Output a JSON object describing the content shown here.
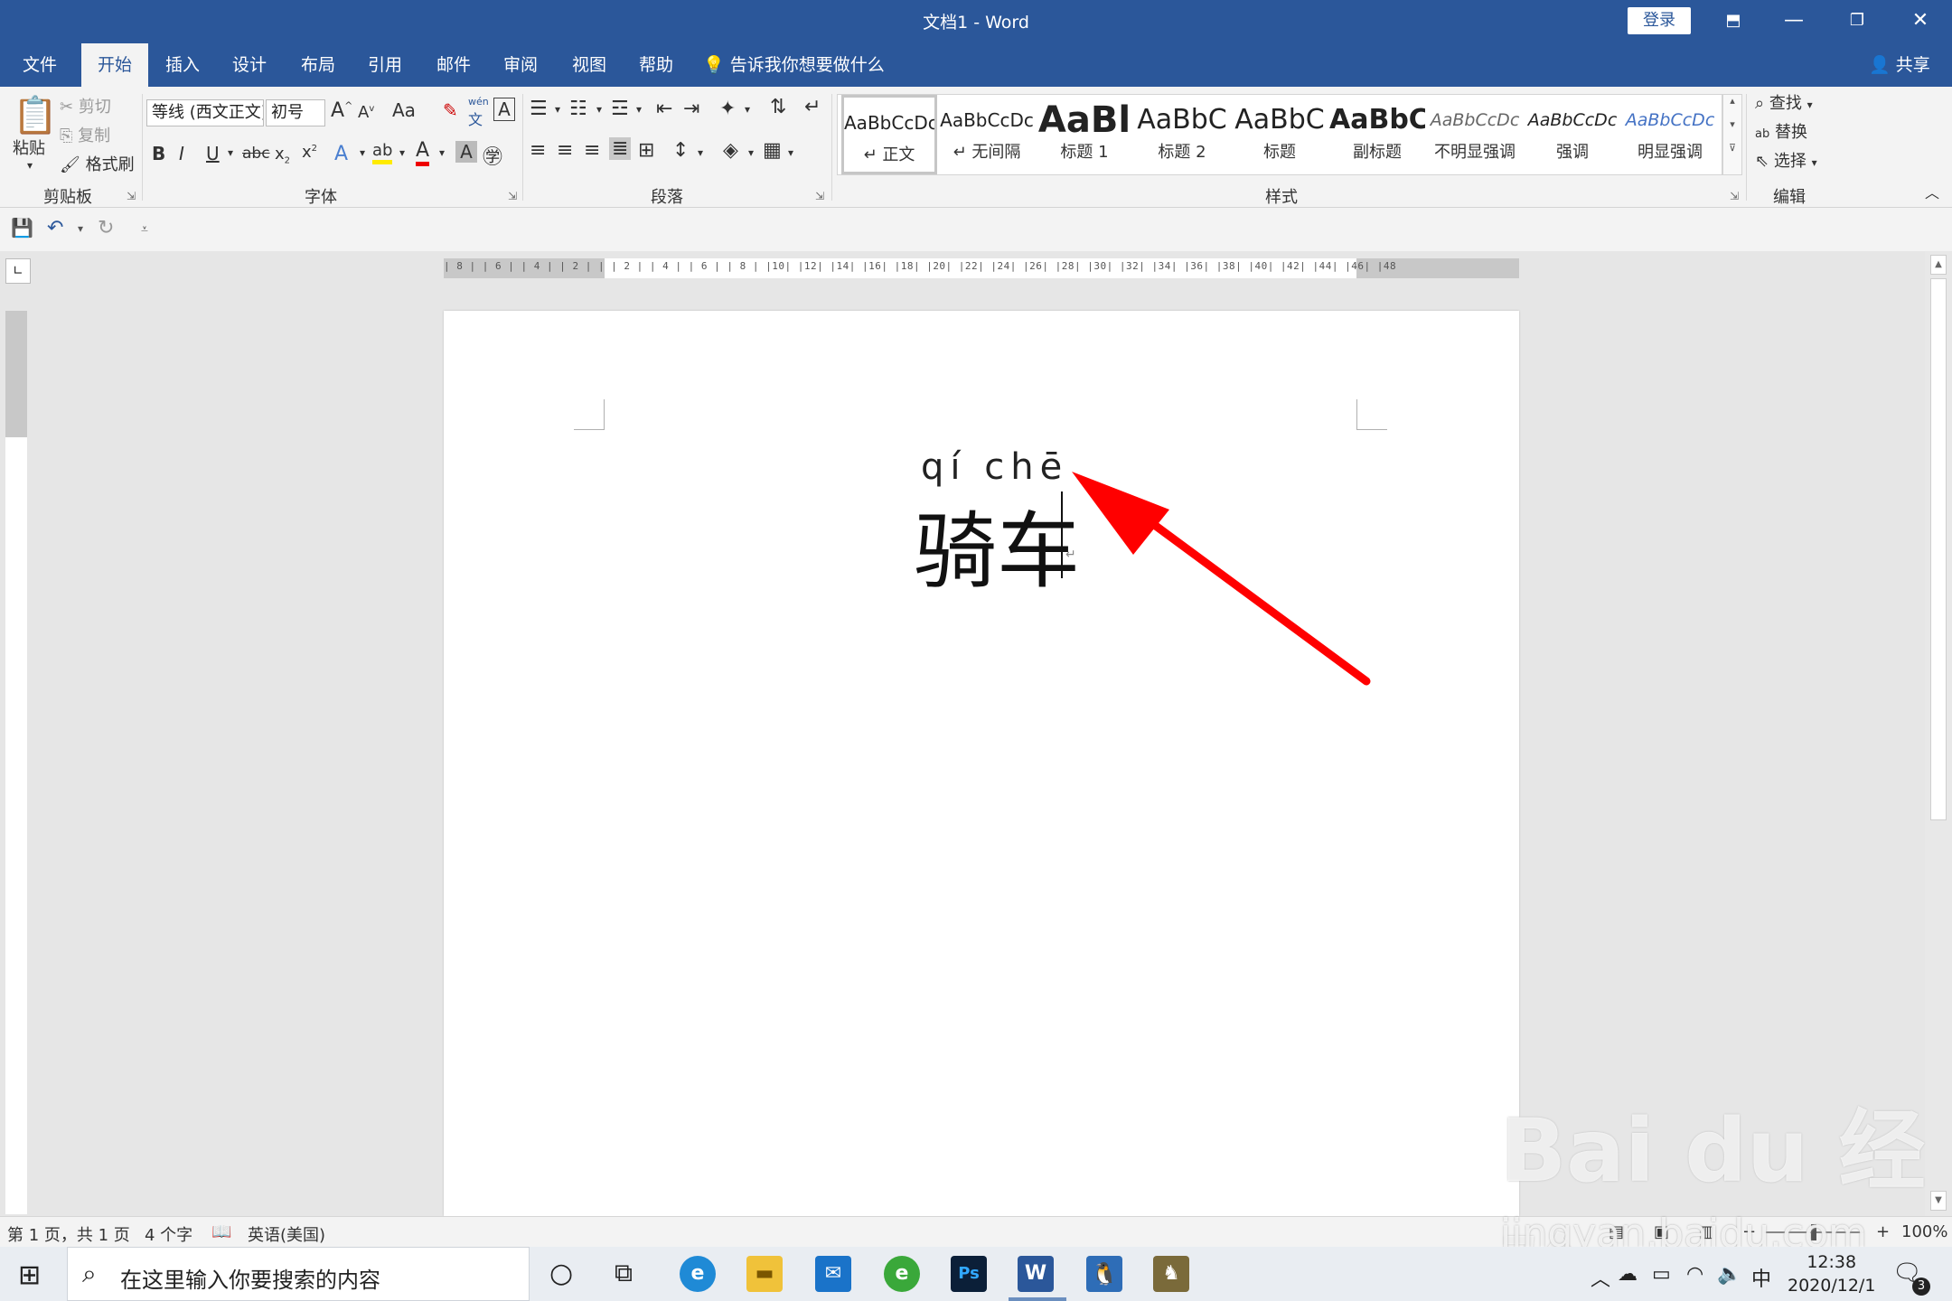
{
  "window": {
    "title": "文档1  -  Word",
    "login": "登录",
    "minimize": "—",
    "restore": "❐",
    "close": "✕",
    "ribbon_display": "⬒"
  },
  "tabs": [
    "文件",
    "开始",
    "插入",
    "设计",
    "布局",
    "引用",
    "邮件",
    "审阅",
    "视图",
    "帮助"
  ],
  "tell_me": "告诉我你想要做什么",
  "share": "共享",
  "clipboard": {
    "paste": "粘贴",
    "cut": "剪切",
    "copy": "复制",
    "format_painter": "格式刷",
    "label": "剪贴板"
  },
  "font": {
    "name": "等线 (西文正文)",
    "size": "初号",
    "change_case": "Aa",
    "label": "字体",
    "pinyin_small": "wén"
  },
  "paragraph": {
    "label": "段落"
  },
  "styles": {
    "label": "样式",
    "items": [
      {
        "sample": "AaBbCcDc",
        "name": "↵ 正文"
      },
      {
        "sample": "AaBbCcDc",
        "name": "↵ 无间隔"
      },
      {
        "sample": "AaBl",
        "name": "标题 1"
      },
      {
        "sample": "AaBbC",
        "name": "标题 2"
      },
      {
        "sample": "AaBbC",
        "name": "标题"
      },
      {
        "sample": "AaBbC",
        "name": "副标题"
      },
      {
        "sample": "AaBbCcDc",
        "name": "不明显强调"
      },
      {
        "sample": "AaBbCcDc",
        "name": "强调"
      },
      {
        "sample": "AaBbCcDc",
        "name": "明显强调"
      }
    ]
  },
  "editing": {
    "find": "查找",
    "replace": "替换",
    "select": "选择",
    "label": "编辑"
  },
  "ruler": {
    "h_ticks": "| 8 |   | 6 |   | 4 |   | 2 |   |     | 2 |   | 4 |   | 6 |   | 8 |   |10|   |12|   |14|   |16|   |18|   |20|   |22|   |24|   |26|   |28|   |30|   |32|   |34|   |36|   |38|   |40|   |42|   |44|   |46|   |48"
  },
  "document": {
    "ruby": "qí chē",
    "text": "骑车"
  },
  "status": {
    "page": "第 1 页，共 1 页",
    "words": "4 个字",
    "language": "英语(美国)",
    "zoom": "100%"
  },
  "taskbar": {
    "search_placeholder": "在这里输入你要搜索的内容",
    "time": "12:38",
    "date": "2020/12/1",
    "ime": "中",
    "notifications": "3"
  },
  "watermark": {
    "brand": "Bai du 经验",
    "url": "jingyan.baidu.com"
  },
  "colors": {
    "accent": "#2b579a",
    "arrow": "#ff0000"
  }
}
